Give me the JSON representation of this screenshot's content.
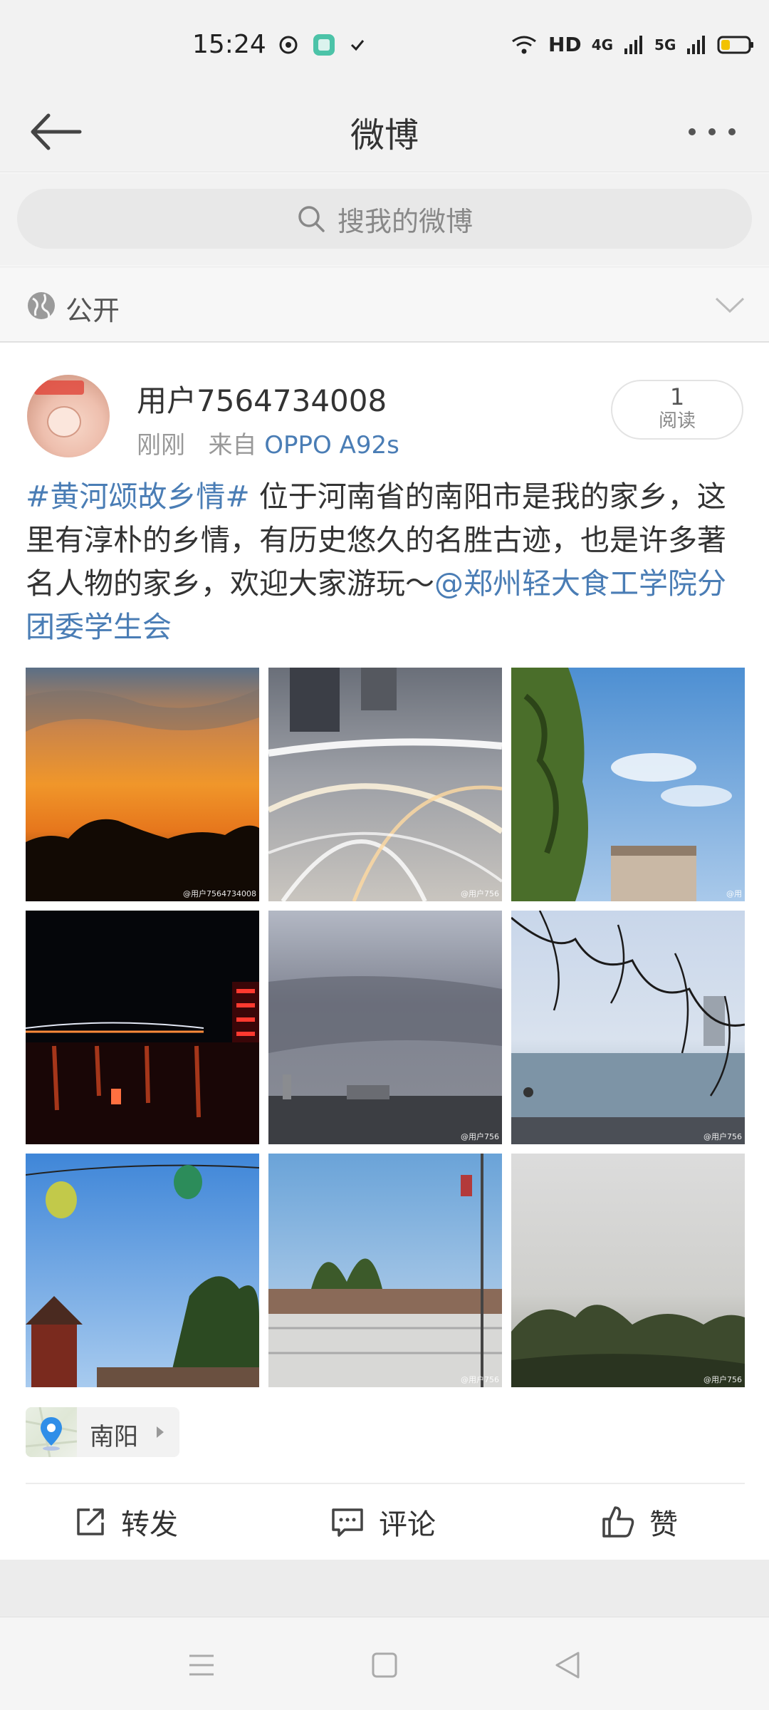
{
  "status_bar": {
    "time": "15:24",
    "hd_label": "HD",
    "net1_label": "4G",
    "net2_label": "5G"
  },
  "nav": {
    "title": "微博"
  },
  "search": {
    "placeholder": "搜我的微博"
  },
  "visibility": {
    "label": "公开"
  },
  "post": {
    "username": "用户7564734008",
    "time": "刚刚",
    "source_prefix": "来自",
    "device": "OPPO A92s",
    "read_count": "1",
    "read_label": "阅读",
    "hashtag": "#黄河颂故乡情#",
    "body": " 位于河南省的南阳市是我的家乡，这里有淳朴的乡情，有历史悠久的名胜古迹，也是许多著名人物的家乡，欢迎大家游玩～",
    "mention": "@郑州轻大食工学院分团委学生会",
    "photos": [
      {
        "name": "sunset",
        "watermark": "@用户7564734008"
      },
      {
        "name": "light-trails",
        "watermark": "@用户756"
      },
      {
        "name": "tree-sky",
        "watermark": "@用"
      },
      {
        "name": "night-river",
        "watermark": ""
      },
      {
        "name": "cloudy-city",
        "watermark": "@用户756"
      },
      {
        "name": "lake-branches",
        "watermark": "@用户756"
      },
      {
        "name": "pavilion-lanterns",
        "watermark": ""
      },
      {
        "name": "bridge-park",
        "watermark": "@用户756"
      },
      {
        "name": "hazy-hills",
        "watermark": "@用户756"
      }
    ],
    "location": "南阳"
  },
  "actions": {
    "repost": "转发",
    "comment": "评论",
    "like": "赞"
  },
  "colors": {
    "link": "#4a7db5",
    "background": "#f2f2f2"
  }
}
